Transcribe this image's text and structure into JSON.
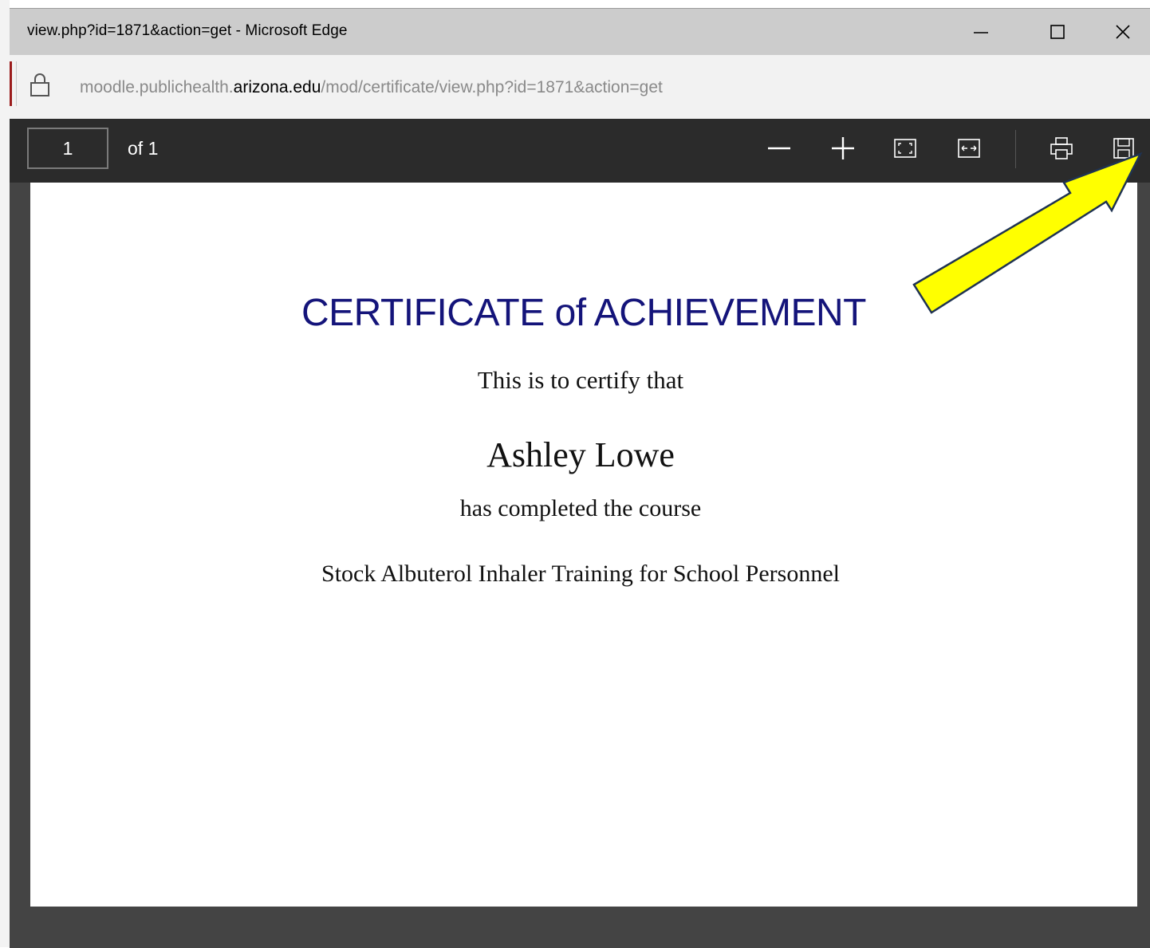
{
  "window": {
    "title": "view.php?id=1871&action=get - Microsoft Edge",
    "controls": [
      "minimize-icon",
      "maximize-icon",
      "close-icon"
    ]
  },
  "address": {
    "url_prefix": "moodle.publichealth.",
    "url_domain": "arizona.edu",
    "url_suffix": "/mod/certificate/view.php?id=1871&action=get"
  },
  "pdf_toolbar": {
    "page_number": "1",
    "page_count_label": "of 1",
    "tools": [
      "zoom-out-icon",
      "zoom-in-icon",
      "fit-page-icon",
      "fit-width-icon",
      "print-icon",
      "save-icon"
    ]
  },
  "certificate": {
    "title": "CERTIFICATE of ACHIEVEMENT",
    "intro": "This is to certify that",
    "recipient": "Ashley Lowe",
    "completed": "has completed the course",
    "course": "Stock Albuterol Inhaler Training for School Personnel"
  },
  "colors": {
    "title_blue": "#14147a",
    "arrow_yellow": "#ffff00",
    "arrow_outline": "#1f3352"
  }
}
